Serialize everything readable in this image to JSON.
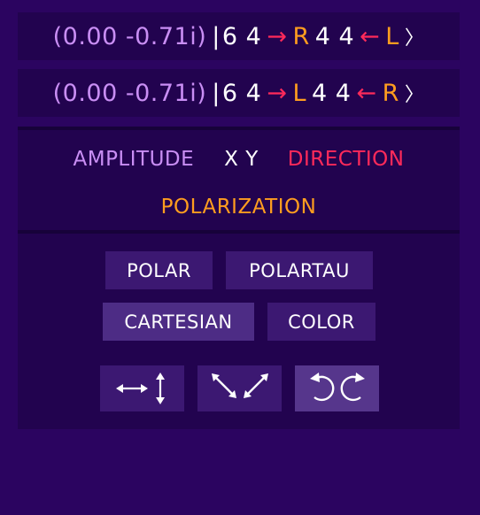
{
  "kets": [
    {
      "amplitude": "(0.00 -0.71i)",
      "bar": "|",
      "pre": "6 4",
      "arrow1": "→",
      "pol1": "R",
      "mid": "4 4",
      "arrow2": "←",
      "pol2": "L",
      "close": "〉"
    },
    {
      "amplitude": "(0.00 -0.71i)",
      "bar": "|",
      "pre": "6 4",
      "arrow1": "→",
      "pol1": "L",
      "mid": "4 4",
      "arrow2": "←",
      "pol2": "R",
      "close": "〉"
    }
  ],
  "legend": {
    "amplitude": "AMPLITUDE",
    "xy": "X Y",
    "direction": "DIRECTION",
    "polarization": "POLARIZATION"
  },
  "buttons": {
    "polar": "POLAR",
    "polartau": "POLARTAU",
    "cartesian": "CARTESIAN",
    "color": "COLOR"
  },
  "icons": {
    "linear_hv": "horizontal-vertical-arrows-icon",
    "linear_diag": "diagonal-arrows-icon",
    "circular": "circular-arrows-icon"
  },
  "colors": {
    "background": "#2b0460",
    "panel": "#22034f",
    "amplitude": "#c98ef4",
    "direction": "#ff2a5a",
    "polarization": "#ff9d1f",
    "button": "#3c1872",
    "button_active": "#4d2c85"
  }
}
